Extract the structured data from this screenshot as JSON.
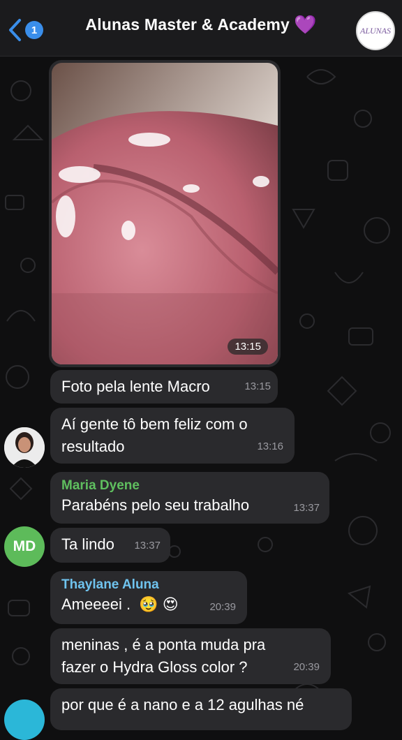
{
  "header": {
    "back_count": "1",
    "title": "Alunas Master & Academy",
    "heart": "💜",
    "logo_text": "ALUNAS"
  },
  "messages": [
    {
      "text": "Foto pela lente Macro",
      "time": "13:15"
    },
    {
      "text_line1": "Aí gente tô bem feliz com o",
      "text_line2": "resultado",
      "time": "13:16"
    },
    {
      "sender": "Maria Dyene",
      "sender_color": "#5fbf5f",
      "text": "Parabéns pelo seu trabalho",
      "time": "13:37"
    },
    {
      "avatar_initials": "MD",
      "text": "Ta lindo",
      "time": "13:37"
    },
    {
      "sender": "Thaylane Aluna",
      "sender_color": "#6fc3ee",
      "text": "Ameeeei .",
      "emojis": "🥹 😍",
      "time": "20:39"
    },
    {
      "text_line1": "meninas , é a ponta muda pra",
      "text_line2": "fazer o Hydra Gloss color ?",
      "time": "20:39"
    },
    {
      "text": "por que é a nano e a 12 agulhas né"
    }
  ],
  "photo": {
    "time": "13:15"
  },
  "colors": {
    "accent": "#3a8eea",
    "bubble": "#2a2a2d",
    "background": "#0f0f10",
    "md_avatar": "#5dbb5a"
  }
}
